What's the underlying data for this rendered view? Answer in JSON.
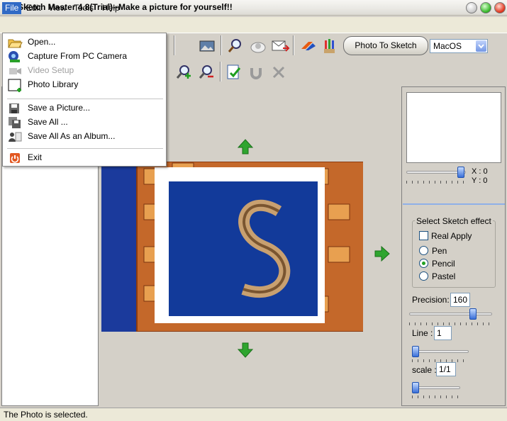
{
  "window": {
    "title": "Sketch Master 4.8(Trial)--Make a picture for yourself!!"
  },
  "menubar": {
    "items": [
      "File",
      "Edit",
      "View",
      "Tools",
      "Help"
    ]
  },
  "file_menu": {
    "items": [
      {
        "label": "Open...",
        "icon": "folder-open-icon",
        "enabled": true
      },
      {
        "label": "Capture From PC Camera",
        "icon": "camera-icon",
        "enabled": true
      },
      {
        "label": "Video Setup",
        "icon": "video-icon",
        "enabled": false
      },
      {
        "label": "Photo Library",
        "icon": "photo-library-icon",
        "enabled": true
      },
      {
        "label": "Save a Picture...",
        "icon": "save-icon",
        "enabled": true
      },
      {
        "label": "Save All ...",
        "icon": "save-all-icon",
        "enabled": true
      },
      {
        "label": "Save All As an Album...",
        "icon": "save-album-icon",
        "enabled": true
      },
      {
        "label": "Exit",
        "icon": "exit-icon",
        "enabled": true
      }
    ]
  },
  "toolbar": {
    "photo_to_sketch": "Photo To Sketch",
    "style_select": {
      "selected": "MacOS"
    }
  },
  "preview": {
    "x_label": "X : 0",
    "y_label": "Y : 0"
  },
  "effect_panel": {
    "group_title": "Select Sketch effect",
    "real_apply": {
      "label": "Real Apply",
      "checked": false
    },
    "options": [
      {
        "label": "Pen",
        "checked": false
      },
      {
        "label": "Pencil",
        "checked": true
      },
      {
        "label": "Pastel",
        "checked": false
      }
    ],
    "precision_label": "Precision:",
    "precision_value": "160",
    "line_label": "Line :",
    "line_value": "1",
    "scale_label": "scale :",
    "scale_value": "1/1"
  },
  "status": {
    "text": "The Photo is selected."
  },
  "colors": {
    "menu_highlight": "#316ac5",
    "arrow_green": "#2fa52f",
    "canvas_blue": "#1b3a9c",
    "frame_orange": "#c4682a"
  }
}
